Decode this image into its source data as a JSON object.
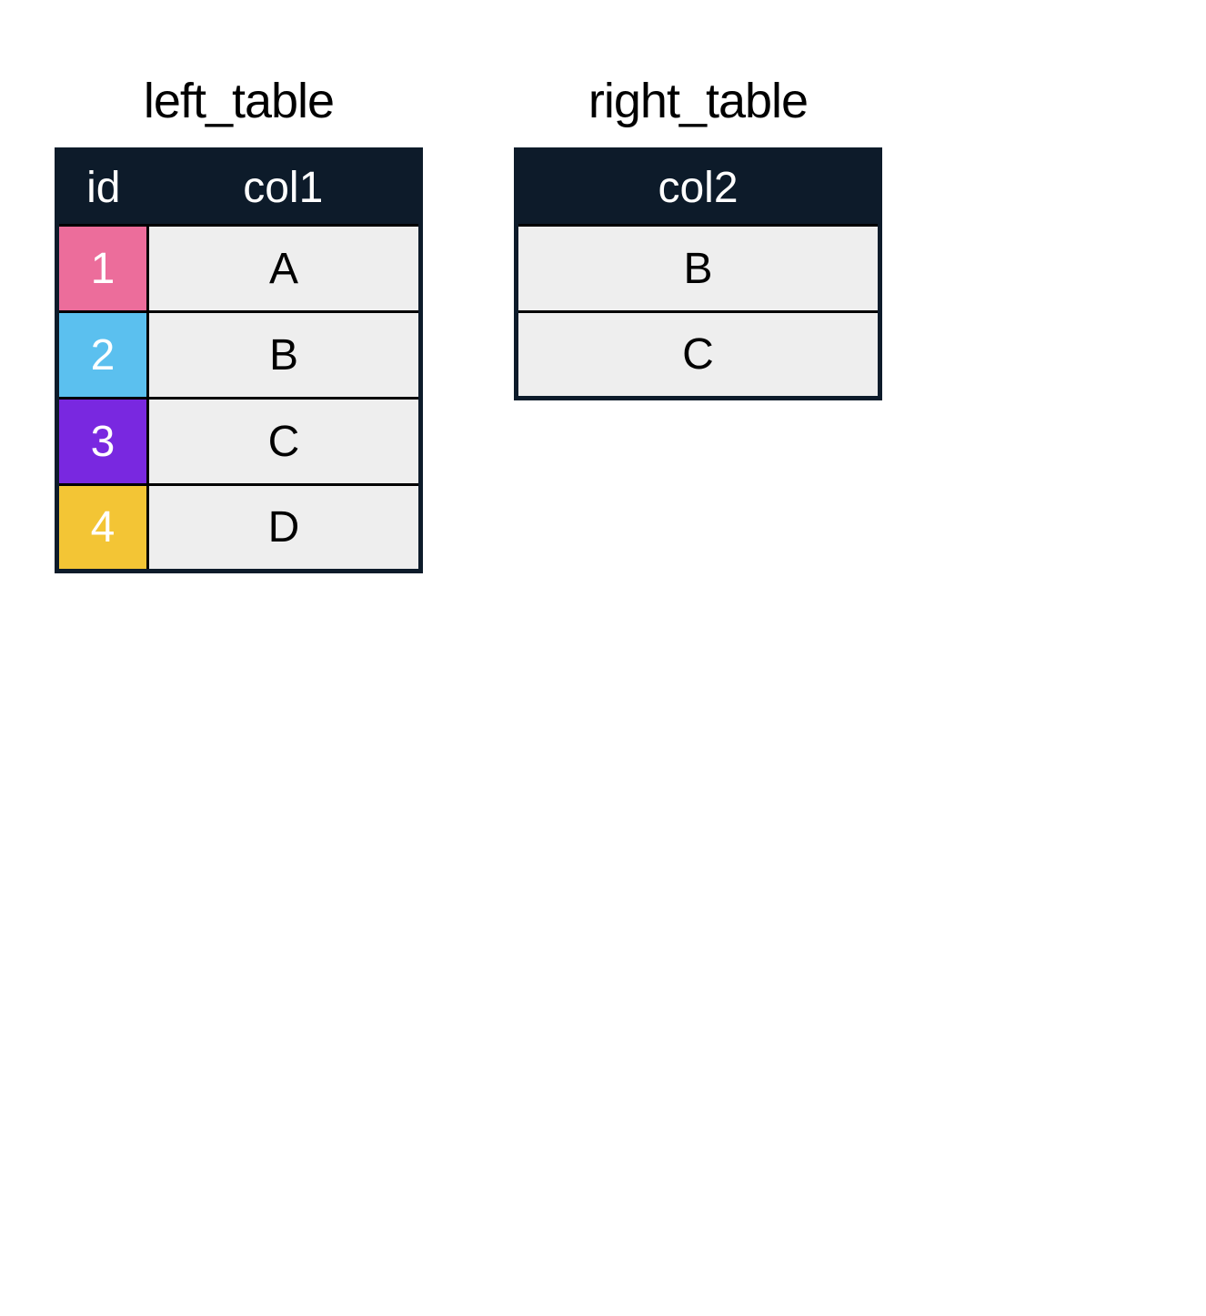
{
  "left_table": {
    "title": "left_table",
    "headers": {
      "id": "id",
      "col1": "col1"
    },
    "rows": [
      {
        "id": "1",
        "col1": "A",
        "color": "pink"
      },
      {
        "id": "2",
        "col1": "B",
        "color": "blue"
      },
      {
        "id": "3",
        "col1": "C",
        "color": "purple"
      },
      {
        "id": "4",
        "col1": "D",
        "color": "yellow"
      }
    ]
  },
  "right_table": {
    "title": "right_table",
    "headers": {
      "col2": "col2"
    },
    "rows": [
      {
        "col2": "B"
      },
      {
        "col2": "C"
      }
    ]
  },
  "colors": {
    "header_bg": "#0d1b2a",
    "cell_bg": "#eeeeee",
    "pink": "#ec6d9b",
    "blue": "#5bc0ef",
    "purple": "#7928e0",
    "yellow": "#f3c535"
  }
}
